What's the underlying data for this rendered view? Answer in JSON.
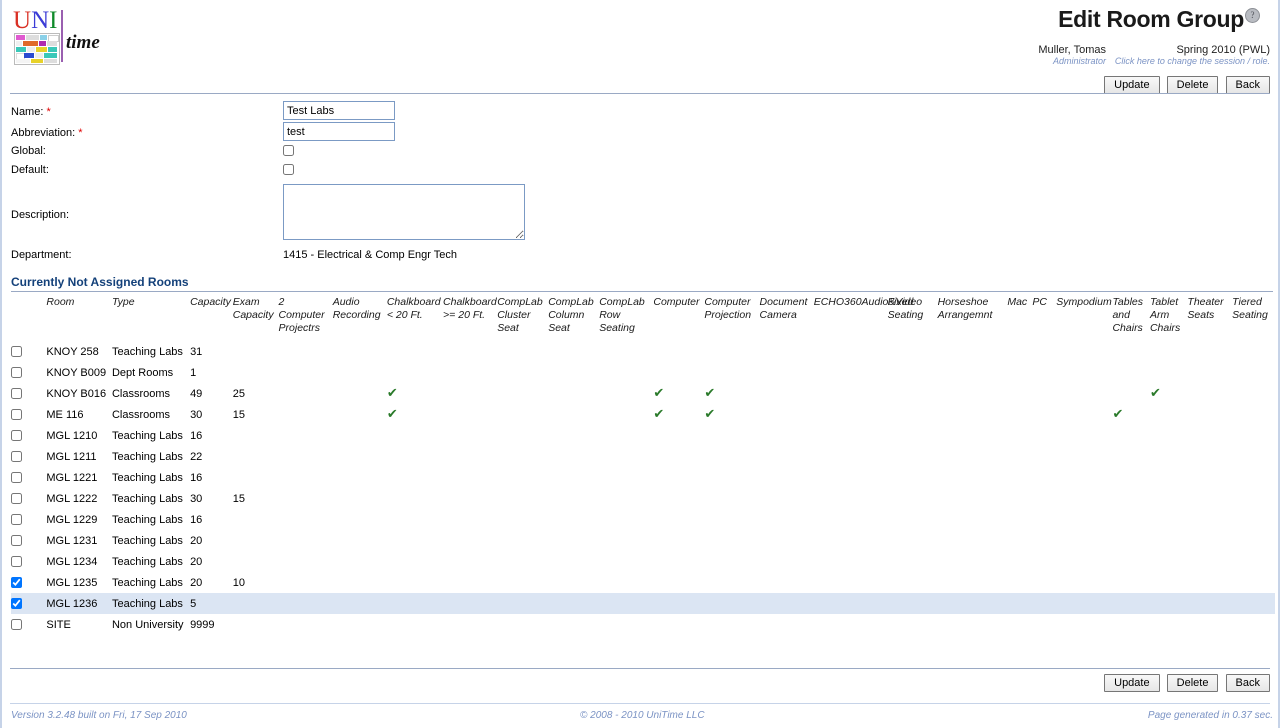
{
  "app": {
    "logo_uni": [
      "U",
      "N",
      "I"
    ],
    "logo_time": "time"
  },
  "header": {
    "title": "Edit Room Group",
    "help_icon": "help-icon",
    "user_name": "Muller, Tomas",
    "user_role": "Administrator",
    "session_name": "Spring 2010 (PWL)",
    "session_note": "Click here to change the session / role."
  },
  "buttons": {
    "update": "Update",
    "delete": "Delete",
    "back": "Back"
  },
  "form": {
    "name_label": "Name:",
    "name_value": "Test Labs",
    "abbreviation_label": "Abbreviation:",
    "abbreviation_value": "test",
    "global_label": "Global:",
    "global_checked": false,
    "default_label": "Default:",
    "default_checked": false,
    "description_label": "Description:",
    "description_value": "",
    "department_label": "Department:",
    "department_value": "1415 - Electrical & Comp Engr Tech",
    "required_marker": "*"
  },
  "section": {
    "title": "Currently Not Assigned Rooms"
  },
  "table": {
    "columns": [
      {
        "key": "check",
        "label": ""
      },
      {
        "key": "room",
        "label": "Room"
      },
      {
        "key": "type",
        "label": "Type"
      },
      {
        "key": "capacity",
        "label": "Capacity"
      },
      {
        "key": "exam_capacity",
        "label": "Exam Capacity"
      },
      {
        "key": "two_computer_projectrs",
        "label": "2 Computer Projectrs"
      },
      {
        "key": "audio_recording",
        "label": "Audio Recording"
      },
      {
        "key": "chalkboard_lt_20ft",
        "label": "Chalkboard < 20 Ft."
      },
      {
        "key": "chalkboard_gte_20ft",
        "label": "Chalkboard >= 20 Ft."
      },
      {
        "key": "complab_cluster_seat",
        "label": "CompLab Cluster Seat"
      },
      {
        "key": "complab_column_seat",
        "label": "CompLab Column Seat"
      },
      {
        "key": "complab_row_seating",
        "label": "CompLab Row Seating"
      },
      {
        "key": "computer",
        "label": "Computer"
      },
      {
        "key": "computer_projection",
        "label": "Computer Projection"
      },
      {
        "key": "document_camera",
        "label": "Document Camera"
      },
      {
        "key": "echo360",
        "label": "ECHO360Audio&Video"
      },
      {
        "key": "fixed_seating",
        "label": "Fixed Seating"
      },
      {
        "key": "horseshoe_arrangemnt",
        "label": "Horseshoe Arrangemnt"
      },
      {
        "key": "mac",
        "label": "Mac"
      },
      {
        "key": "pc",
        "label": "PC"
      },
      {
        "key": "sympodium",
        "label": "Sympodium"
      },
      {
        "key": "tables_and_chairs",
        "label": "Tables and Chairs"
      },
      {
        "key": "tablet_arm_chairs",
        "label": "Tablet Arm Chairs"
      },
      {
        "key": "theater_seats",
        "label": "Theater Seats"
      },
      {
        "key": "tiered_seating",
        "label": "Tiered Seating"
      }
    ],
    "check_glyph": "✔",
    "rows": [
      {
        "checked": false,
        "selected": false,
        "room": "KNOY 258",
        "type": "Teaching Labs",
        "capacity": "31",
        "exam_capacity": "",
        "features": []
      },
      {
        "checked": false,
        "selected": false,
        "room": "KNOY B009",
        "type": "Dept Rooms",
        "capacity": "1",
        "exam_capacity": "",
        "features": []
      },
      {
        "checked": false,
        "selected": false,
        "room": "KNOY B016",
        "type": "Classrooms",
        "capacity": "49",
        "exam_capacity": "25",
        "features": [
          "chalkboard_lt_20ft",
          "computer",
          "computer_projection",
          "tablet_arm_chairs"
        ]
      },
      {
        "checked": false,
        "selected": false,
        "room": "ME 116",
        "type": "Classrooms",
        "capacity": "30",
        "exam_capacity": "15",
        "features": [
          "chalkboard_lt_20ft",
          "computer",
          "computer_projection",
          "tables_and_chairs"
        ]
      },
      {
        "checked": false,
        "selected": false,
        "room": "MGL 1210",
        "type": "Teaching Labs",
        "capacity": "16",
        "exam_capacity": "",
        "features": []
      },
      {
        "checked": false,
        "selected": false,
        "room": "MGL 1211",
        "type": "Teaching Labs",
        "capacity": "22",
        "exam_capacity": "",
        "features": []
      },
      {
        "checked": false,
        "selected": false,
        "room": "MGL 1221",
        "type": "Teaching Labs",
        "capacity": "16",
        "exam_capacity": "",
        "features": []
      },
      {
        "checked": false,
        "selected": false,
        "room": "MGL 1222",
        "type": "Teaching Labs",
        "capacity": "30",
        "exam_capacity": "15",
        "features": []
      },
      {
        "checked": false,
        "selected": false,
        "room": "MGL 1229",
        "type": "Teaching Labs",
        "capacity": "16",
        "exam_capacity": "",
        "features": []
      },
      {
        "checked": false,
        "selected": false,
        "room": "MGL 1231",
        "type": "Teaching Labs",
        "capacity": "20",
        "exam_capacity": "",
        "features": []
      },
      {
        "checked": false,
        "selected": false,
        "room": "MGL 1234",
        "type": "Teaching Labs",
        "capacity": "20",
        "exam_capacity": "",
        "features": []
      },
      {
        "checked": true,
        "selected": false,
        "room": "MGL 1235",
        "type": "Teaching Labs",
        "capacity": "20",
        "exam_capacity": "10",
        "features": []
      },
      {
        "checked": true,
        "selected": true,
        "room": "MGL 1236",
        "type": "Teaching Labs",
        "capacity": "5",
        "exam_capacity": "",
        "features": []
      },
      {
        "checked": false,
        "selected": false,
        "room": "SITE",
        "type": "Non University",
        "capacity": "9999",
        "exam_capacity": "",
        "features": []
      }
    ]
  },
  "footer": {
    "version": "Version 3.2.48 built on Fri, 17 Sep 2010",
    "copyright": "© 2008 - 2010 UniTime LLC",
    "generated": "Page generated in 0.37 sec."
  },
  "colors": {
    "frame": "#c6d3e8",
    "section_heading": "#14417a",
    "selected_row": "#dbe5f3",
    "check_green": "#2a7a2a",
    "muted_link": "#7b93c4",
    "required": "#e00000"
  }
}
